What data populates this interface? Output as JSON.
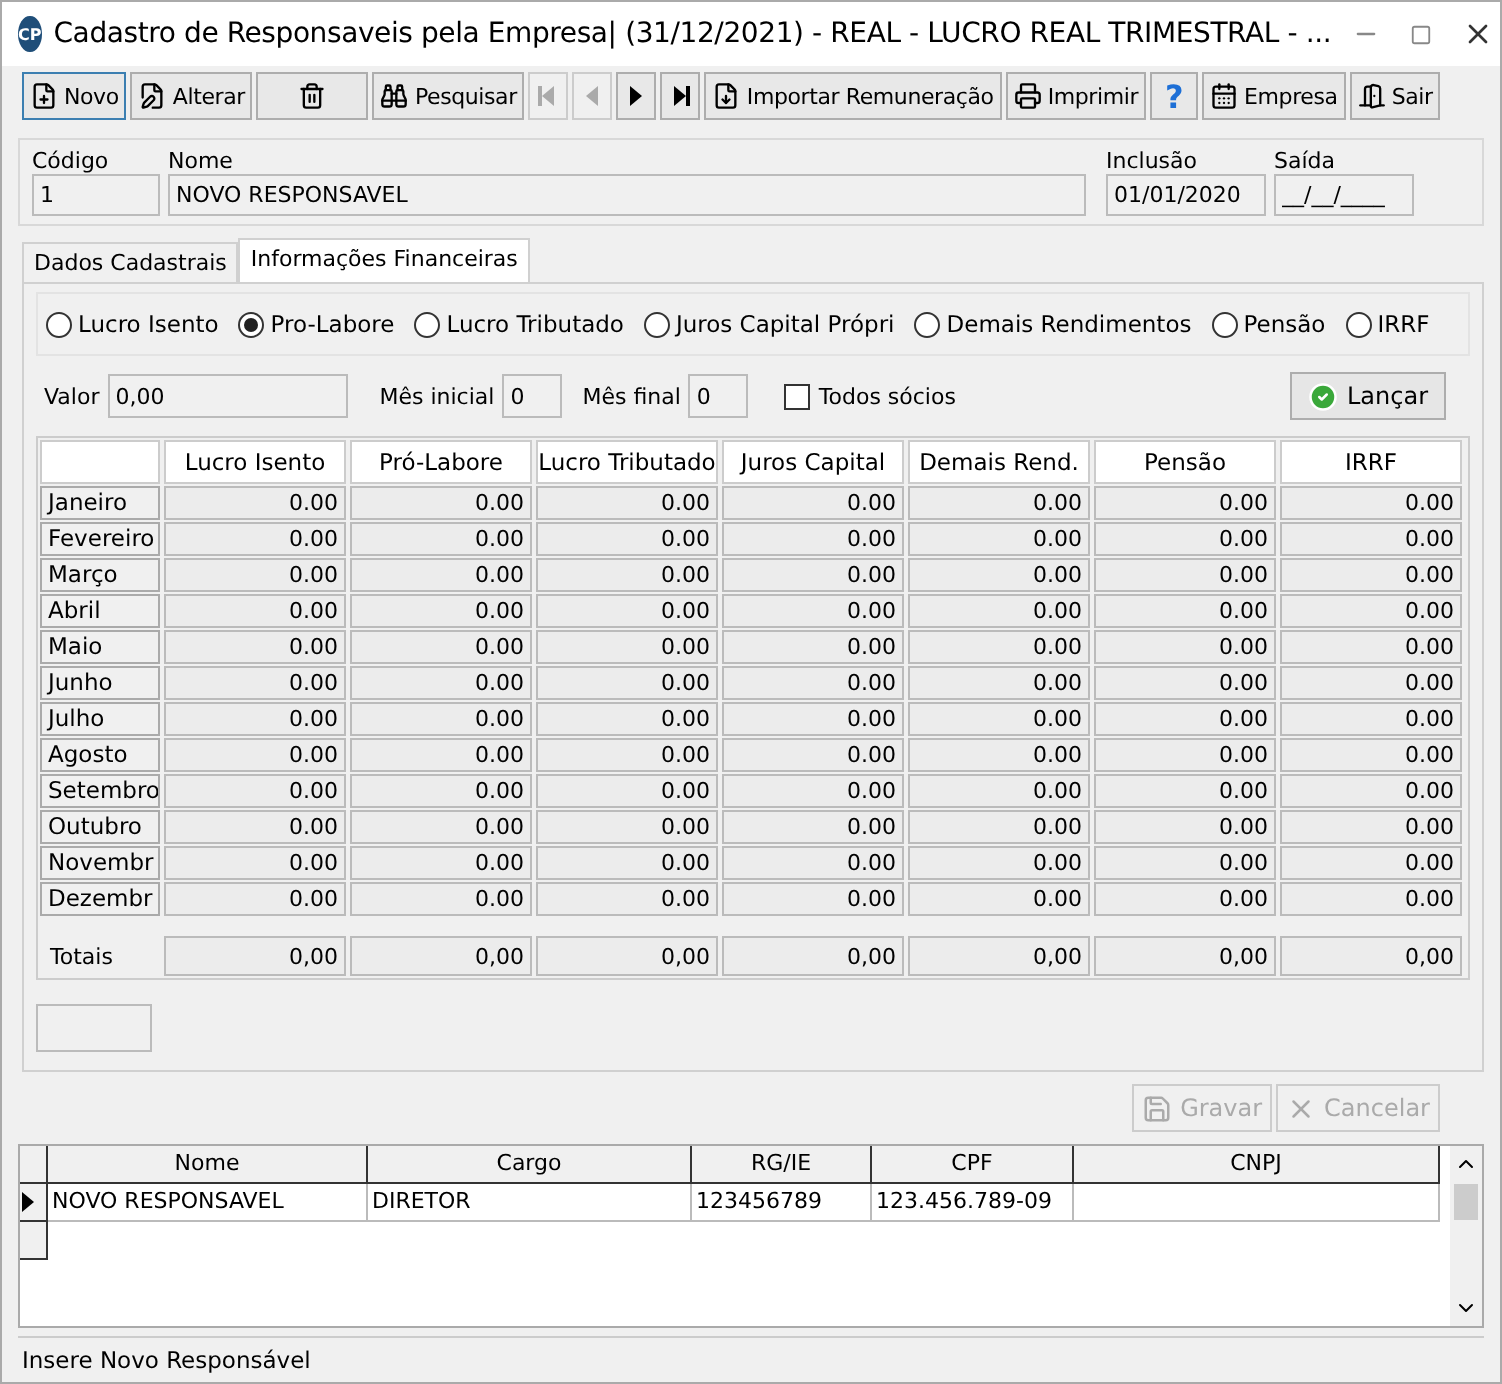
{
  "window": {
    "title": "Cadastro de Responsaveis pela Empresa| (31/12/2021) - REAL - LUCRO REAL TRIMESTRAL  - ...",
    "logo": "CP"
  },
  "toolbar": [
    {
      "kind": "button",
      "label": "Novo",
      "disabled": false,
      "focused": true
    },
    {
      "kind": "button",
      "label": "Alterar",
      "disabled": false,
      "focused": false
    },
    {
      "kind": "button",
      "disabled": false,
      "focused": false
    },
    {
      "kind": "button",
      "label": "Pesquisar",
      "disabled": false,
      "focused": false
    },
    {
      "kind": "nav",
      "disabled": true
    },
    {
      "kind": "nav",
      "disabled": true
    },
    {
      "kind": "nav",
      "disabled": false
    },
    {
      "kind": "nav",
      "disabled": false
    },
    {
      "kind": "button",
      "label": "Importar Remuneração",
      "disabled": false,
      "focused": false
    },
    {
      "kind": "button",
      "label": "Imprimir",
      "disabled": false,
      "focused": false
    },
    {
      "kind": "help",
      "label": "?",
      "disabled": false,
      "focused": false
    },
    {
      "kind": "button",
      "label": "Empresa",
      "disabled": false,
      "focused": false
    },
    {
      "kind": "button",
      "label": "Sair",
      "disabled": false,
      "focused": false
    }
  ],
  "header": {
    "codigo": {
      "label": "Código",
      "value": "1"
    },
    "nome": {
      "label": "Nome",
      "value": "NOVO RESPONSAVEL"
    },
    "inclusao": {
      "label": "Inclusão",
      "value": "01/01/2020"
    },
    "saida": {
      "label": "Saída",
      "value": "__/__/____"
    }
  },
  "tabs": [
    {
      "label": "Dados Cadastrais",
      "selected": false
    },
    {
      "label": "Informações Financeiras",
      "selected": true
    }
  ],
  "options": [
    {
      "label": "Lucro Isento",
      "selected": false
    },
    {
      "label": "Pro-Labore",
      "selected": true
    },
    {
      "label": "Lucro Tributado",
      "selected": false
    },
    {
      "label": "Juros Capital Própri",
      "selected": false
    },
    {
      "label": "Demais Rendimentos",
      "selected": false
    },
    {
      "label": "Pensão",
      "selected": false
    },
    {
      "label": "IRRF",
      "selected": false
    }
  ],
  "entry": {
    "valor_label": "Valor",
    "valor": "0,00",
    "mes_inicial_label": "Mês inicial",
    "mes_inicial": "0",
    "mes_final_label": "Mês final",
    "mes_final": "0",
    "todos_label": "Todos sócios",
    "todos_checked": false,
    "launch": "Lançar"
  },
  "table": {
    "columns": [
      "Lucro Isento",
      "Pró-Labore",
      "Lucro Tributado",
      "Juros Capital",
      "Demais Rend.",
      "Pensão",
      "IRRF"
    ],
    "rows": [
      {
        "month": "Janeiro",
        "values": [
          "0.00",
          "0.00",
          "0.00",
          "0.00",
          "0.00",
          "0.00",
          "0.00"
        ]
      },
      {
        "month": "Fevereiro",
        "values": [
          "0.00",
          "0.00",
          "0.00",
          "0.00",
          "0.00",
          "0.00",
          "0.00"
        ]
      },
      {
        "month": "Março",
        "values": [
          "0.00",
          "0.00",
          "0.00",
          "0.00",
          "0.00",
          "0.00",
          "0.00"
        ]
      },
      {
        "month": "Abril",
        "values": [
          "0.00",
          "0.00",
          "0.00",
          "0.00",
          "0.00",
          "0.00",
          "0.00"
        ]
      },
      {
        "month": "Maio",
        "values": [
          "0.00",
          "0.00",
          "0.00",
          "0.00",
          "0.00",
          "0.00",
          "0.00"
        ]
      },
      {
        "month": "Junho",
        "values": [
          "0.00",
          "0.00",
          "0.00",
          "0.00",
          "0.00",
          "0.00",
          "0.00"
        ]
      },
      {
        "month": "Julho",
        "values": [
          "0.00",
          "0.00",
          "0.00",
          "0.00",
          "0.00",
          "0.00",
          "0.00"
        ]
      },
      {
        "month": "Agosto",
        "values": [
          "0.00",
          "0.00",
          "0.00",
          "0.00",
          "0.00",
          "0.00",
          "0.00"
        ]
      },
      {
        "month": "Setembro",
        "values": [
          "0.00",
          "0.00",
          "0.00",
          "0.00",
          "0.00",
          "0.00",
          "0.00"
        ]
      },
      {
        "month": "Outubro",
        "values": [
          "0.00",
          "0.00",
          "0.00",
          "0.00",
          "0.00",
          "0.00",
          "0.00"
        ]
      },
      {
        "month": "Novembr",
        "values": [
          "0.00",
          "0.00",
          "0.00",
          "0.00",
          "0.00",
          "0.00",
          "0.00"
        ]
      },
      {
        "month": "Dezembr",
        "values": [
          "0.00",
          "0.00",
          "0.00",
          "0.00",
          "0.00",
          "0.00",
          "0.00"
        ]
      }
    ],
    "totals_label": "Totais",
    "totals": [
      "0,00",
      "0,00",
      "0,00",
      "0,00",
      "0,00",
      "0,00",
      "0,00"
    ]
  },
  "actions": [
    {
      "label": "Gravar",
      "disabled": true
    },
    {
      "label": "Cancelar",
      "disabled": true
    }
  ],
  "grid": {
    "columns": [
      "Nome",
      "Cargo",
      "RG/IE",
      "CPF",
      "CNPJ"
    ],
    "rows": [
      {
        "selected": true,
        "cells": [
          "NOVO RESPONSAVEL",
          "DIRETOR",
          "123456789",
          "123.456.789-09",
          ""
        ]
      }
    ]
  },
  "status_bar": "Insere Novo Responsável"
}
